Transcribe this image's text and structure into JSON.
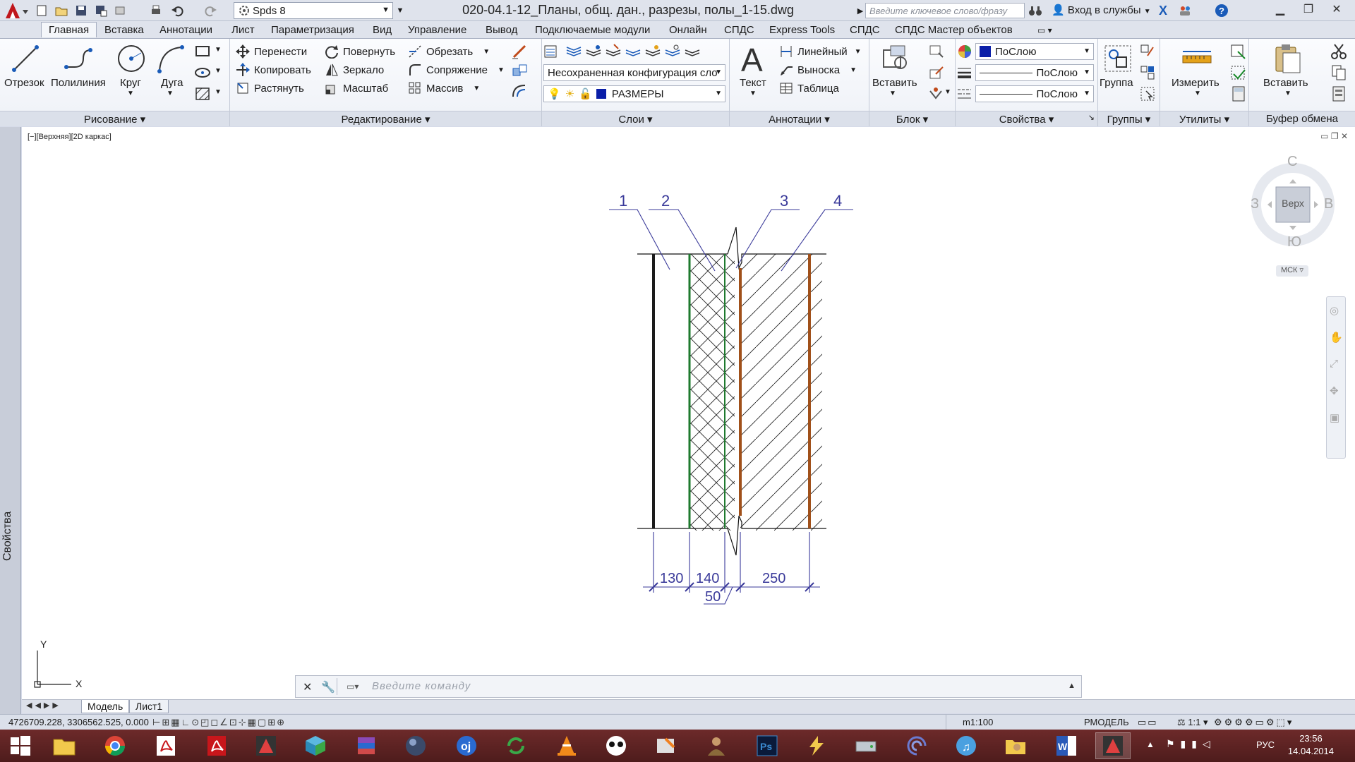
{
  "titlebar": {
    "workspace": "Spds 8",
    "document_title": "020-04.1-12_Планы, общ. дан., разрезы, полы_1-15.dwg",
    "search_placeholder": "Введите ключевое слово/фразу",
    "signin_label": "Вход в службы"
  },
  "tabs": [
    "Главная",
    "Вставка",
    "Аннотации",
    "Лист",
    "Параметризация",
    "Вид",
    "Управление",
    "Вывод",
    "Подключаемые модули",
    "Онлайн",
    "СПДС",
    "Express Tools",
    "СПДС",
    "СПДС Мастер объектов"
  ],
  "ribbon": {
    "draw": {
      "title": "Рисование",
      "line": "Отрезок",
      "polyline": "Полилиния",
      "circle": "Круг",
      "arc": "Дуга"
    },
    "modify": {
      "title": "Редактирование",
      "move": "Перенести",
      "rotate": "Повернуть",
      "trim": "Обрезать",
      "copy": "Копировать",
      "mirror": "Зеркало",
      "fillet": "Сопряжение",
      "stretch": "Растянуть",
      "scale": "Масштаб",
      "array": "Массив"
    },
    "layers": {
      "title": "Слои",
      "layer_state": "Несохраненная конфигурация сло",
      "current_layer": "РАЗМЕРЫ",
      "current_layer_color": "#0a1ea8"
    },
    "annotation": {
      "title": "Аннотации",
      "text": "Текст",
      "linear": "Линейный",
      "leader": "Выноска",
      "table": "Таблица"
    },
    "block": {
      "title": "Блок",
      "insert": "Вставить"
    },
    "properties": {
      "title": "Свойства",
      "color": "ПоСлою",
      "lineweight": "ПоСлою",
      "linetype": "ПоСлою",
      "color_swatch": "#0a1ea8"
    },
    "groups": {
      "title": "Группы",
      "group": "Группа"
    },
    "utilities": {
      "title": "Утилиты",
      "measure": "Измерить"
    },
    "clipboard": {
      "title": "Буфер обмена",
      "paste": "Вставить"
    }
  },
  "sidebar": {
    "label": "Свойства"
  },
  "viewport": {
    "label": "[−][Верхняя][2D каркас]"
  },
  "drawing": {
    "callouts": [
      "1",
      "2",
      "3",
      "4"
    ],
    "dimensions": [
      "130",
      "140",
      "50",
      "250"
    ],
    "colors": {
      "annotation": "#3a3a9a",
      "layer1_edge": "#1a1a1a",
      "layer2_edge": "#1e7a2e",
      "layer3_edge": "#a0501a",
      "hatch": "#222222"
    }
  },
  "viewcube": {
    "north": "С",
    "south": "Ю",
    "west": "З",
    "east": "В",
    "face": "Верх",
    "ucs": "МСК"
  },
  "commandline": {
    "placeholder": "Введите команду"
  },
  "layout_tabs": [
    "Модель",
    "Лист1"
  ],
  "statusbar": {
    "coords": "4726709.228, 3306562.525, 0.000",
    "scale": "m1:100",
    "space": "РМОДЕЛЬ",
    "annotation_scale": "1:1"
  },
  "taskbar": {
    "language": "РУС",
    "time": "23:56",
    "date": "14.04.2014"
  }
}
